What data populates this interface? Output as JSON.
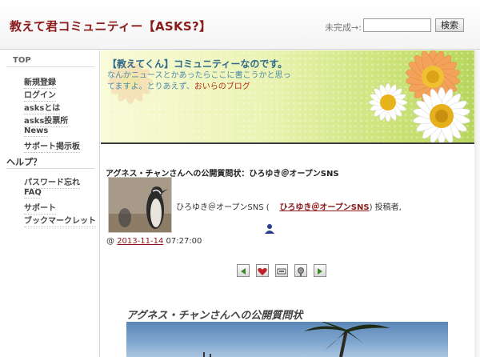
{
  "header": {
    "site_title": "教えて君コミュニティー【ASKS?】",
    "search_label": "未完成→:",
    "search_value": "",
    "search_button": "検索"
  },
  "sidebar": {
    "top_label": "TOP",
    "items": [
      {
        "label": "新規登録"
      },
      {
        "label": "ログイン"
      },
      {
        "label": "asksとは"
      },
      {
        "label": "asks投票所"
      },
      {
        "label": "News"
      },
      {
        "label": "サポート掲示板"
      }
    ],
    "help_title": "ヘルプ？",
    "help_items": [
      {
        "label": "パスワード忘れ"
      },
      {
        "label": "FAQ"
      },
      {
        "label": "サポート"
      },
      {
        "label": "ブックマークレット"
      }
    ]
  },
  "banner": {
    "title": "【教えてくん】コミュニティーなのです。",
    "line1": "なんかニュースとかあったらここに書こうかと思っ",
    "line2_prefix": "てますよ。とりあえず、",
    "blog_link": "おいらのブログ"
  },
  "post": {
    "title": "アグネス・チャンさんへの公開質問状：ひろゆき＠オープンSNS",
    "author_prefix": "ひろゆき＠オープンSNS (",
    "author_link": "ひろゆき＠オープンSNS",
    "author_suffix": ") 投稿者,",
    "date_prefix": "@ ",
    "date_link": "2013-11-14",
    "time": " 07:27:00"
  },
  "icons": [
    "arrow-left-icon",
    "heart-icon",
    "tag-icon",
    "settings-icon",
    "arrow-right-icon"
  ],
  "article": {
    "title": "アグネス・チャンさんへの公開質問状"
  },
  "colors": {
    "title_red": "#8b1a1a",
    "banner_blue": "#2f6a8a",
    "link_red": "#8b1a1a"
  }
}
